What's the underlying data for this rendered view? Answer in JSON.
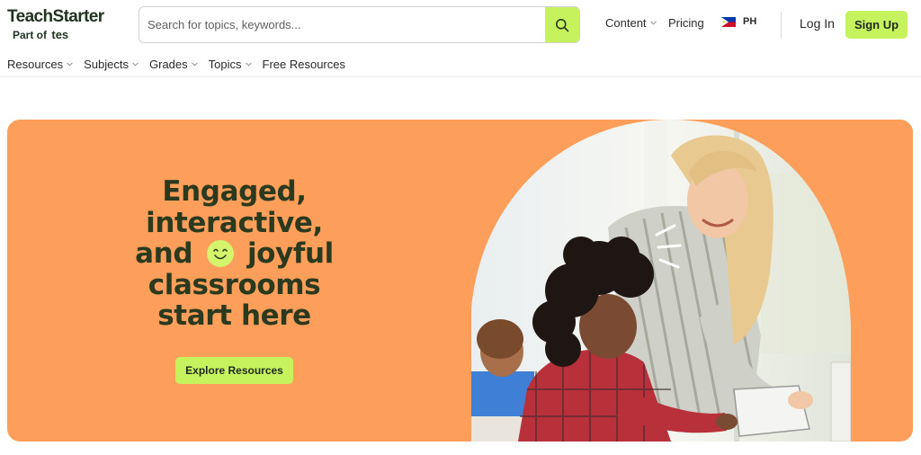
{
  "header": {
    "logo": {
      "name": "TeachStarter",
      "part_of_prefix": "Part of",
      "part_of_brand": "tes"
    },
    "search": {
      "placeholder": "Search for topics, keywords...",
      "value": "",
      "icon": "search-icon"
    },
    "nav": [
      {
        "label": "Content",
        "has_dropdown": true
      },
      {
        "label": "Pricing",
        "has_dropdown": false
      }
    ],
    "region": {
      "code": "PH",
      "icon": "philippines-flag-icon"
    },
    "login_label": "Log In",
    "signup_label": "Sign Up"
  },
  "subnav": [
    {
      "label": "Resources",
      "has_dropdown": true
    },
    {
      "label": "Subjects",
      "has_dropdown": true
    },
    {
      "label": "Grades",
      "has_dropdown": true
    },
    {
      "label": "Topics",
      "has_dropdown": true
    },
    {
      "label": "Free Resources",
      "has_dropdown": false
    }
  ],
  "hero": {
    "headline": {
      "line1": "Engaged,",
      "line2": "interactive,",
      "line3_before": "and",
      "line3_after": "joyful",
      "line4": "classrooms",
      "line5": "start here"
    },
    "headline_icon": "smiley-face-icon",
    "cta_label": "Explore Resources",
    "image": "teacher-helping-student-with-tablet-photo"
  },
  "colors": {
    "accent_green": "#c6f25d",
    "hero_orange": "#fd9f5b",
    "headline_text": "#2b3a1e"
  }
}
